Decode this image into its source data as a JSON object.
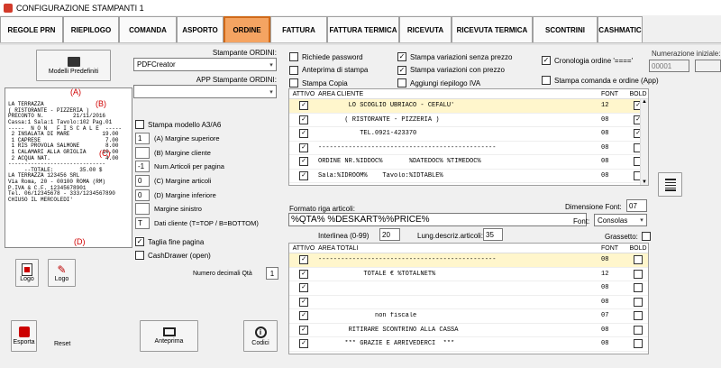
{
  "window": {
    "title": "CONFIGURAZIONE STAMPANTI 1"
  },
  "tabs": [
    "REGOLE PRN",
    "RIEPILOGO",
    "COMANDA",
    "ASPORTO",
    "ORDINE",
    "FATTURA",
    "FATTURA TERMICA",
    "RICEVUTA",
    "RICEVUTA TERMICA",
    "SCONTRINI",
    "CASHMATIC"
  ],
  "active_tab": "ORDINE",
  "left": {
    "modelli_button": "Modelli Predefiniti",
    "receipt_text": "LA TERRAZZA\n( RISTORANTE - PIZZERIA )\nPRECONTO N.         21/11/2016\nCassa:1 Sala:1 Tavolo:102 Pag.01\n-----  N O N   F I S C A L E  -----\n 2 INSALATA DI MARE          19.00\n 1 CAPRESE                    7.00\n 1 RIS PROVOLA SALMONE        8.00\n 1 CALAMARI ALLA GRIGLIA     16.00\n 2 ACQUA NAT.                 4.00\n------------------------------\n     --TOTALE:        35.00 $\nLA TERRAZZA 123456 SRL\nVia Roma, 20 - 00100 ROMA (RM)\nP.IVA & C.F. 12345678901\nTel. 06/12345678 - 333/1234567890\nCHIUSO IL MERCOLEDI'",
    "markers": [
      "(A)",
      "(B)",
      "(C)",
      "(D)"
    ],
    "logo1": "Logo",
    "logo2": "Logo",
    "esporta": "Esporta",
    "reset": "Reset",
    "anteprima": "Anteprima",
    "codici": "Codici"
  },
  "mid": {
    "stampante_label": "Stampante ORDINI:",
    "stampante_value": "PDFCreator",
    "app_label": "APP Stampante ORDINI:",
    "app_value": "",
    "stampa_a3": "Stampa modello A3/A6",
    "fields": [
      {
        "value": "1",
        "label": "(A) Margine superiore"
      },
      {
        "value": "",
        "label": "(B) Margine cliente"
      },
      {
        "value": "-1",
        "label": "Num.Articoli per pagina"
      },
      {
        "value": "0",
        "label": "(C) Margine articoli"
      },
      {
        "value": "0",
        "label": "(D) Margine inferiore"
      },
      {
        "value": "",
        "label": "Margine sinistro"
      },
      {
        "value": "T",
        "label": "Dati cliente (T=TOP / B=BOTTOM)"
      }
    ],
    "taglia": "Taglia fine pagina",
    "cashdrawer": "CashDrawer (open)",
    "decimali_label": "Numero decimali Qtà",
    "decimali_value": "1"
  },
  "options": {
    "col1": [
      {
        "label": "Richiede password",
        "checked": false
      },
      {
        "label": "Anteprima di stampa",
        "checked": false
      },
      {
        "label": "Stampa Copia",
        "checked": false
      }
    ],
    "col2": [
      {
        "label": "Stampa variazioni senza prezzo",
        "checked": true
      },
      {
        "label": "Stampa variazioni con prezzo",
        "checked": true
      },
      {
        "label": "Aggiungi riepilogo IVA",
        "checked": false
      }
    ],
    "cronologia": {
      "label": "Cronologia ordine '===='",
      "checked": true
    },
    "stampa_comanda": {
      "label": "Stampa comanda e ordine (App)",
      "checked": false
    },
    "numerazione_label": "Numerazione iniziale:",
    "numerazione_value": "00001"
  },
  "grid_cliente": {
    "headers": {
      "attivo": "ATTIVO",
      "area": "AREA CLIENTE",
      "font": "FONT",
      "bold": "BOLD"
    },
    "rows": [
      {
        "attivo": true,
        "text": "        LO SCOGLIO UBRIACO - CEFALU'",
        "font": "12",
        "bold": true
      },
      {
        "attivo": true,
        "text": "       ( RISTORANTE - PIZZERIA )",
        "font": "08",
        "bold": true
      },
      {
        "attivo": true,
        "text": "           TEL.0921-423370",
        "font": "08",
        "bold": true
      },
      {
        "attivo": true,
        "text": "-----------------------------------------------",
        "font": "08",
        "bold": false
      },
      {
        "attivo": true,
        "text": "ORDINE NR.%IDDOC%       %DATEDOC% %TIMEDOC%",
        "font": "08",
        "bold": false
      },
      {
        "attivo": true,
        "text": "Sala:%IDROOM%    Tavolo:%IDTABLE%",
        "font": "08",
        "bold": false
      }
    ]
  },
  "formato": {
    "label": "Formato riga articoli:",
    "value": "%QTA% %DESKART%%PRICE%",
    "interlinea_label": "Interlinea (0-99)",
    "interlinea_value": "20",
    "lung_label": "Lung.descriz.articoli:",
    "lung_value": "35",
    "dimfont_label": "Dimensione Font:",
    "dimfont_value": "07",
    "font_label": "Font:",
    "font_value": "Consolas",
    "grassetto_label": "Grassetto:"
  },
  "grid_totali": {
    "headers": {
      "attivo": "ATTIVO",
      "area": "AREA TOTALI",
      "font": "FONT",
      "bold": "BOLD"
    },
    "rows": [
      {
        "attivo": true,
        "text": "-----------------------------------------------",
        "font": "08",
        "bold": false
      },
      {
        "attivo": true,
        "text": "            TOTALE € %TOTALNET%",
        "font": "12",
        "bold": false
      },
      {
        "attivo": true,
        "text": "",
        "font": "08",
        "bold": false
      },
      {
        "attivo": true,
        "text": "",
        "font": "08",
        "bold": false
      },
      {
        "attivo": true,
        "text": "               non fiscale",
        "font": "07",
        "bold": false
      },
      {
        "attivo": true,
        "text": "        RITIRARE SCONTRINO ALLA CASSA",
        "font": "08",
        "bold": false
      },
      {
        "attivo": true,
        "text": "       *** GRAZIE E ARRIVEDERCI  ***",
        "font": "08",
        "bold": false
      }
    ]
  }
}
